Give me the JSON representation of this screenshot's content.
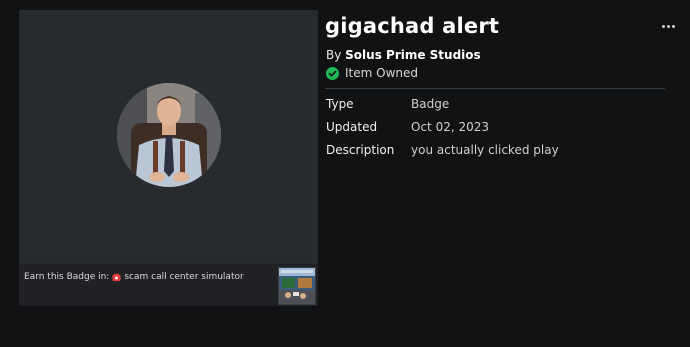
{
  "badge": {
    "title": "gigachad alert",
    "creator_prefix": "By ",
    "creator": "Solus Prime Studios",
    "owned_label": "Item Owned",
    "details": [
      {
        "key": "Type",
        "value": "Badge"
      },
      {
        "key": "Updated",
        "value": "Oct 02, 2023"
      },
      {
        "key": "Description",
        "value": "you actually clicked play"
      }
    ]
  },
  "card": {
    "earn_prefix": "Earn this Badge in:",
    "game_name": "scam call center simulator",
    "phone_icon": "telephone-icon"
  },
  "colors": {
    "background": "#111214",
    "card": "#272a2f",
    "owned_check": "#1fb85a"
  }
}
